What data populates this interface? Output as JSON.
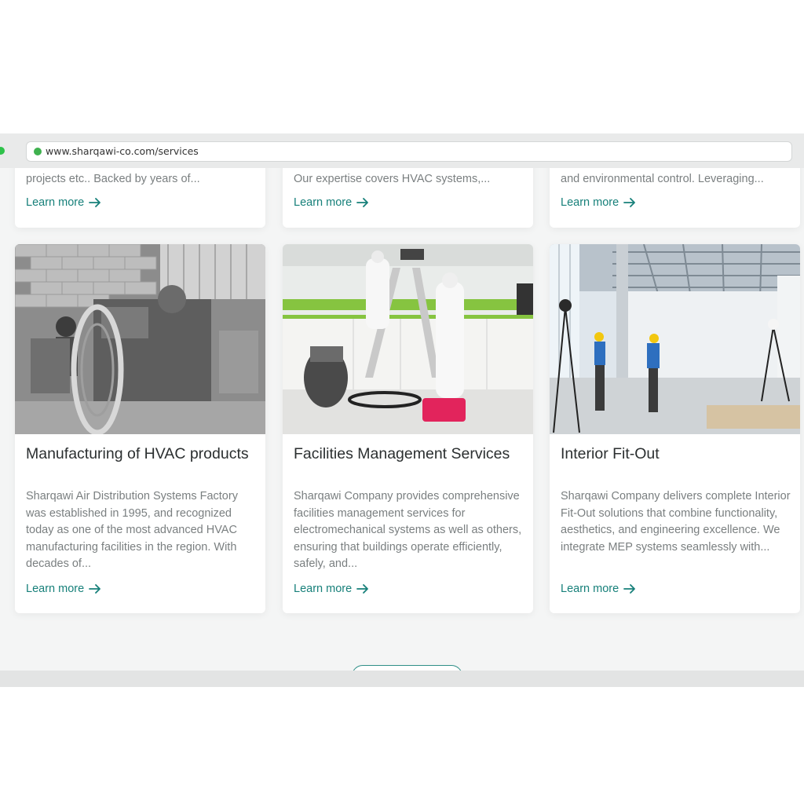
{
  "browser": {
    "url": "www.sharqawi-co.com/services"
  },
  "top_cards": [
    {
      "description": "projects etc.. Backed by years of...",
      "learn_more": "Learn more"
    },
    {
      "description": "Our expertise covers HVAC systems,...",
      "learn_more": "Learn more"
    },
    {
      "description": "and environmental control. Leveraging...",
      "learn_more": "Learn more"
    }
  ],
  "cards": [
    {
      "title": "Manufacturing of HVAC products",
      "description": "Sharqawi Air Distribution Systems Factory was established in 1995, and recognized today as one of the most advanced HVAC manufacturing facilities in the region. With decades of...",
      "learn_more": "Learn more"
    },
    {
      "title": "Facilities Management Services",
      "description": "Sharqawi Company provides comprehensive facilities management services for electromechanical systems as well as others, ensuring that buildings operate efficiently, safely, and...",
      "learn_more": "Learn more"
    },
    {
      "title": "Interior Fit-Out",
      "description": "Sharqawi Company delivers complete Interior Fit-Out solutions that combine functionality, aesthetics, and engineering excellence. We integrate MEP systems seamlessly with...",
      "learn_more": "Learn more"
    }
  ],
  "colors": {
    "accent": "#17807a",
    "text_muted": "#7a7f80",
    "title": "#2b2f30"
  },
  "icons": {
    "learn_more": "arrow-right-icon",
    "secure": "secure-dot-icon"
  }
}
